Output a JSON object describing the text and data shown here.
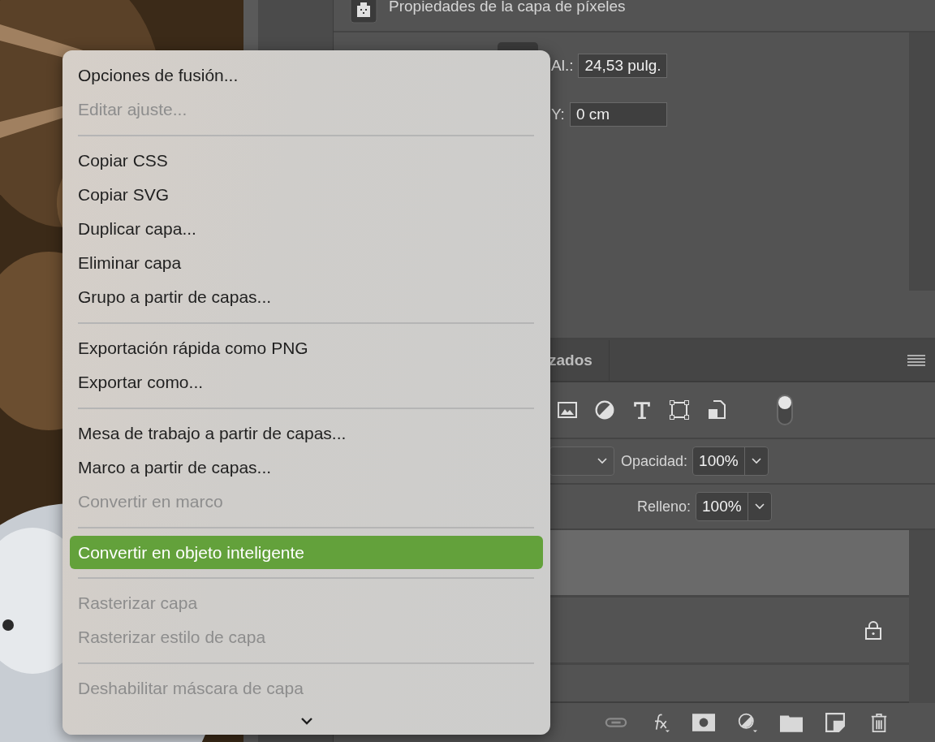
{
  "properties": {
    "title": "Propiedades de la capa de píxeles",
    "fields": [
      {
        "label": "Al.:",
        "value": "24,53 pulg."
      },
      {
        "label": "Y:",
        "value": "0 cm"
      }
    ]
  },
  "layers": {
    "tab": "zados",
    "filter_on": true,
    "opacity": {
      "label": "Opacidad:",
      "value": "100%"
    },
    "fill": {
      "label": "Relleno:",
      "value": "100%"
    },
    "rows": [
      {
        "selected": true,
        "locked": false
      },
      {
        "selected": false,
        "locked": true
      },
      {
        "selected": false,
        "locked": false
      }
    ]
  },
  "context_menu": {
    "more_below": true,
    "items": [
      {
        "kind": "item",
        "label": "Opciones de fusión...",
        "disabled": false,
        "selected": false
      },
      {
        "kind": "item",
        "label": "Editar ajuste...",
        "disabled": true,
        "selected": false
      },
      {
        "kind": "separator"
      },
      {
        "kind": "item",
        "label": "Copiar CSS",
        "disabled": false,
        "selected": false
      },
      {
        "kind": "item",
        "label": "Copiar SVG",
        "disabled": false,
        "selected": false
      },
      {
        "kind": "item",
        "label": "Duplicar capa...",
        "disabled": false,
        "selected": false
      },
      {
        "kind": "item",
        "label": "Eliminar capa",
        "disabled": false,
        "selected": false
      },
      {
        "kind": "item",
        "label": "Grupo a partir de capas...",
        "disabled": false,
        "selected": false
      },
      {
        "kind": "separator"
      },
      {
        "kind": "item",
        "label": "Exportación rápida como PNG",
        "disabled": false,
        "selected": false
      },
      {
        "kind": "item",
        "label": "Exportar como...",
        "disabled": false,
        "selected": false
      },
      {
        "kind": "separator"
      },
      {
        "kind": "item",
        "label": "Mesa de trabajo a partir de capas...",
        "disabled": false,
        "selected": false
      },
      {
        "kind": "item",
        "label": "Marco a partir de capas...",
        "disabled": false,
        "selected": false
      },
      {
        "kind": "item",
        "label": "Convertir en marco",
        "disabled": true,
        "selected": false
      },
      {
        "kind": "separator"
      },
      {
        "kind": "item",
        "label": "Convertir en objeto inteligente",
        "disabled": false,
        "selected": true
      },
      {
        "kind": "separator"
      },
      {
        "kind": "item",
        "label": "Rasterizar capa",
        "disabled": true,
        "selected": false
      },
      {
        "kind": "item",
        "label": "Rasterizar estilo de capa",
        "disabled": true,
        "selected": false
      },
      {
        "kind": "separator"
      },
      {
        "kind": "item",
        "label": "Deshabilitar máscara de capa",
        "disabled": true,
        "selected": false
      }
    ]
  }
}
